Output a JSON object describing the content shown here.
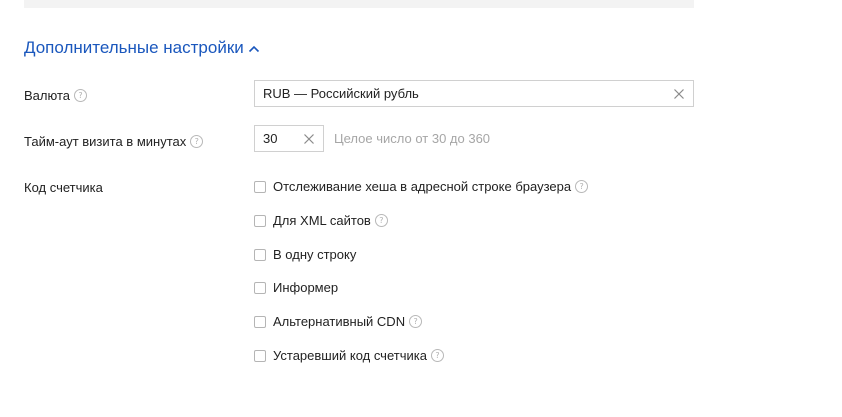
{
  "section": {
    "title": "Дополнительные настройки"
  },
  "currency": {
    "label": "Валюта",
    "value": "RUB — Российский рубль"
  },
  "timeout": {
    "label": "Тайм-аут визита в минутах",
    "value": "30",
    "hint": "Целое число от 30 до 360"
  },
  "counter_code": {
    "label": "Код счетчика",
    "options": [
      {
        "label": "Отслеживание хеша в адресной строке браузера",
        "checked": false,
        "has_help": true
      },
      {
        "label": "Для XML сайтов",
        "checked": false,
        "has_help": true
      },
      {
        "label": "В одну строку",
        "checked": false,
        "has_help": false
      },
      {
        "label": "Информер",
        "checked": false,
        "has_help": false
      },
      {
        "label": "Альтернативный CDN",
        "checked": false,
        "has_help": true
      },
      {
        "label": "Устаревший код счетчика",
        "checked": false,
        "has_help": true
      }
    ]
  },
  "help_glyph": "?",
  "colors": {
    "link": "#1a57bd",
    "hint": "#a6a6a6",
    "border": "#d0d0d0"
  }
}
